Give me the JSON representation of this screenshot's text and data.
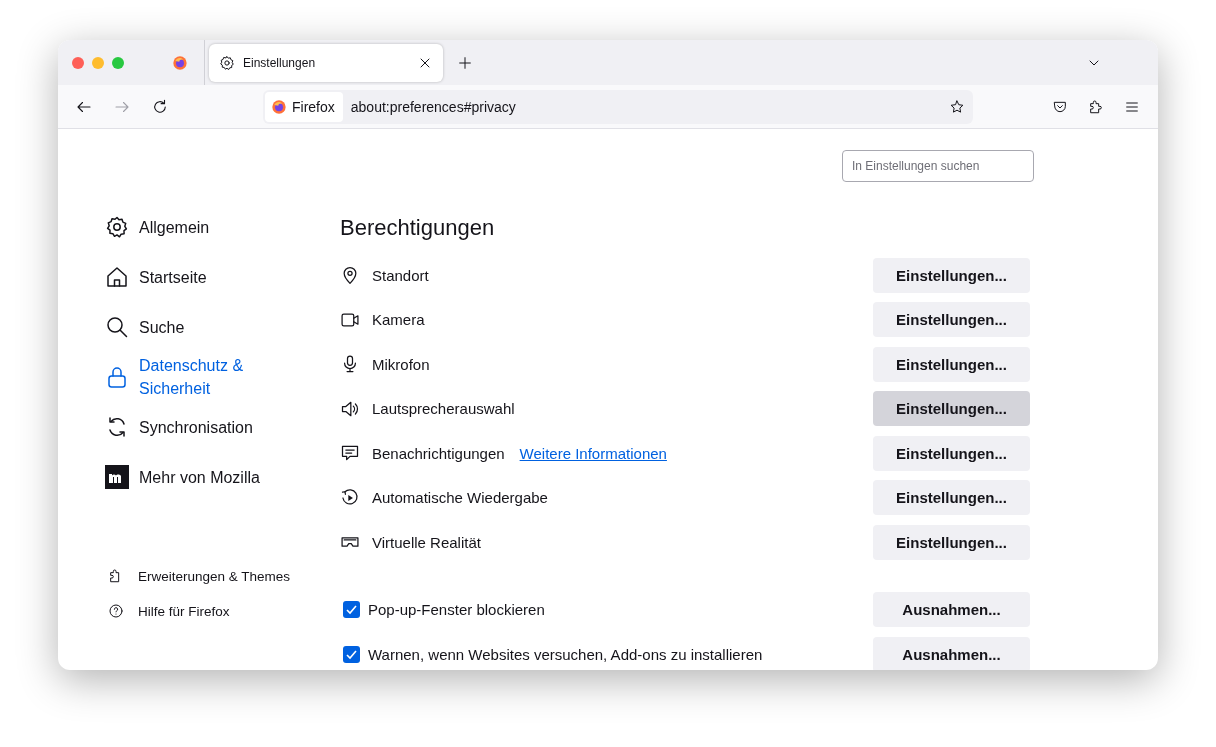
{
  "tab": {
    "title": "Einstellungen",
    "selected": true
  },
  "toolbar": {
    "identity_label": "Firefox",
    "url": "about:preferences#privacy"
  },
  "search": {
    "placeholder": "In Einstellungen suchen"
  },
  "sidebar": {
    "items": [
      {
        "label": "Allgemein",
        "selected": false
      },
      {
        "label": "Startseite",
        "selected": false
      },
      {
        "label": "Suche",
        "selected": false
      },
      {
        "label": "Datenschutz & Sicherheit",
        "selected": true
      },
      {
        "label": "Synchronisation",
        "selected": false
      },
      {
        "label": "Mehr von Mozilla",
        "selected": false
      }
    ],
    "footer_links": [
      {
        "label": "Erweiterungen & Themes"
      },
      {
        "label": "Hilfe für Firefox"
      }
    ]
  },
  "section": {
    "title": "Berechtigungen",
    "rows": [
      {
        "kind": "permission",
        "label": "Standort",
        "button": "Einstellungen...",
        "hovered": false
      },
      {
        "kind": "permission",
        "label": "Kamera",
        "button": "Einstellungen...",
        "hovered": false
      },
      {
        "kind": "permission",
        "label": "Mikrofon",
        "button": "Einstellungen...",
        "hovered": false
      },
      {
        "kind": "permission",
        "label": "Lautsprecherauswahl",
        "button": "Einstellungen...",
        "hovered": true
      },
      {
        "kind": "permission",
        "label": "Benachrichtigungen",
        "link": "Weitere Informationen",
        "button": "Einstellungen...",
        "hovered": false
      },
      {
        "kind": "permission",
        "label": "Automatische Wiedergabe",
        "button": "Einstellungen...",
        "hovered": false
      },
      {
        "kind": "permission",
        "label": "Virtuelle Realität",
        "button": "Einstellungen...",
        "hovered": false
      },
      {
        "kind": "checkbox",
        "label": "Pop-up-Fenster blockieren",
        "checked": true,
        "button": "Ausnahmen...",
        "hovered": false
      },
      {
        "kind": "checkbox",
        "label": "Warnen, wenn Websites versuchen, Add-ons zu installieren",
        "checked": true,
        "button": "Ausnahmen...",
        "hovered": false
      }
    ]
  }
}
